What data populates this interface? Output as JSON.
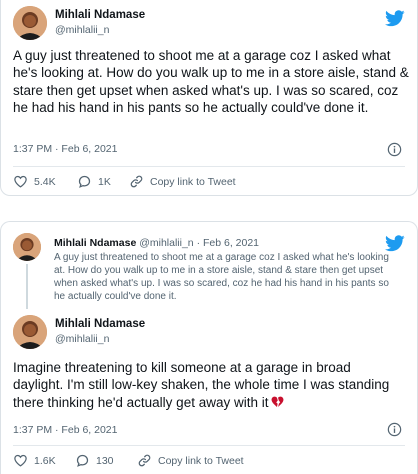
{
  "tweet1": {
    "author_name": "Mihlali Ndamase",
    "author_handle": "@mihlalii_n",
    "text": "A guy just threatened to shoot me at a garage coz I asked what he's looking at. How do you walk up to me in a store aisle, stand & stare then get upset when asked what's up. I was so scared, coz he had his hand in his pants so he actually could've done it.",
    "timestamp": "1:37 PM · Feb 6, 2021",
    "likes": "5.4K",
    "replies": "1K",
    "share_label": "Copy link to Tweet"
  },
  "tweet2": {
    "quoted": {
      "author_name": "Mihlali Ndamase",
      "author_handle": "@mihlalii_n",
      "date": "· Feb 6, 2021",
      "text": "A guy just threatened to shoot me at a garage coz I asked what he's looking at. How do you walk up to me in a store aisle, stand & stare then get upset when asked what's up. I was so scared, coz he had his hand in his pants so he actually could've done it."
    },
    "author_name": "Mihlali Ndamase",
    "author_handle": "@mihlalii_n",
    "text": "Imagine threatening to kill someone at a garage in broad daylight. I'm still low-key shaken, the whole time I was standing there thinking he'd actually get away with it",
    "timestamp": "1:37 PM · Feb 6, 2021",
    "likes": "1.6K",
    "replies": "130",
    "share_label": "Copy link to Tweet"
  },
  "colors": {
    "twitter_blue": "#1d9bf0",
    "text_primary": "#0f1419",
    "text_secondary": "#536471",
    "border": "#dbe1e6",
    "broken_heart": "#c8102e"
  },
  "icons": [
    "twitter-bird-icon",
    "info-icon",
    "heart-icon",
    "reply-icon",
    "link-icon",
    "broken-heart-emoji"
  ]
}
